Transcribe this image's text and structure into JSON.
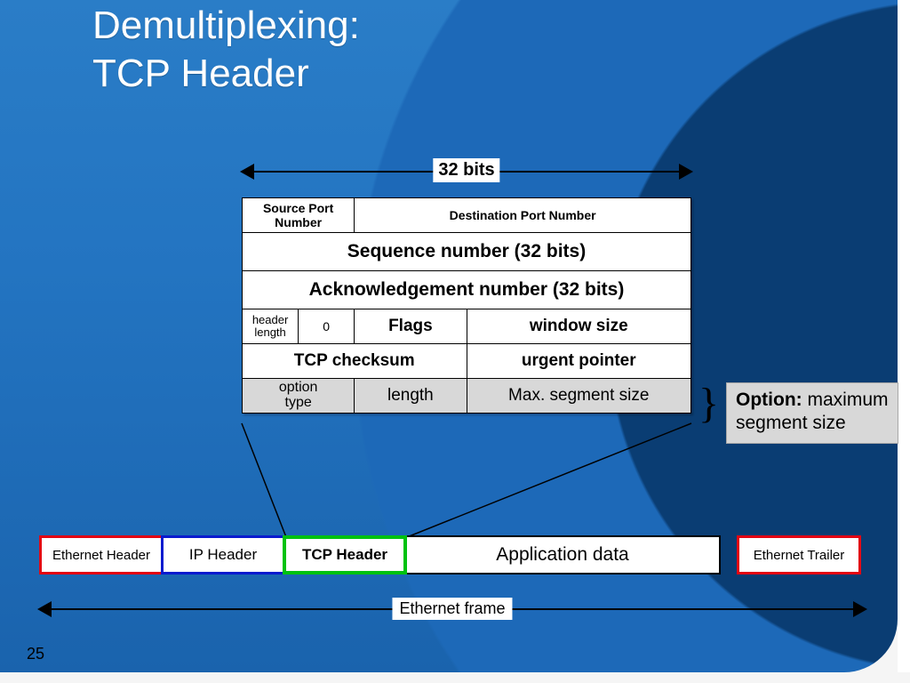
{
  "title_line1": "Demultiplexing:",
  "title_line2": "TCP Header",
  "page_number": "25",
  "bits_label": "32 bits",
  "header_fields": {
    "src_port": "Source Port Number",
    "dst_port": "Destination Port Number",
    "seq": "Sequence number (32 bits)",
    "ack": "Acknowledgement number (32 bits)",
    "hlen": "header\nlength",
    "reserved": "0",
    "flags": "Flags",
    "wsize": "window size",
    "chksum": "TCP checksum",
    "urgptr": "urgent pointer",
    "opt_type": "option\ntype",
    "opt_len": "length",
    "opt_mss": "Max. segment size"
  },
  "option_box": {
    "heading": "Option:",
    "body": "maximum segment size"
  },
  "frame_segments": {
    "eth_header": "Ethernet Header",
    "ip_header": "IP Header",
    "tcp_header": "TCP Header",
    "app_data": "Application data",
    "eth_trailer": "Ethernet Trailer"
  },
  "ethernet_frame_label": "Ethernet frame"
}
